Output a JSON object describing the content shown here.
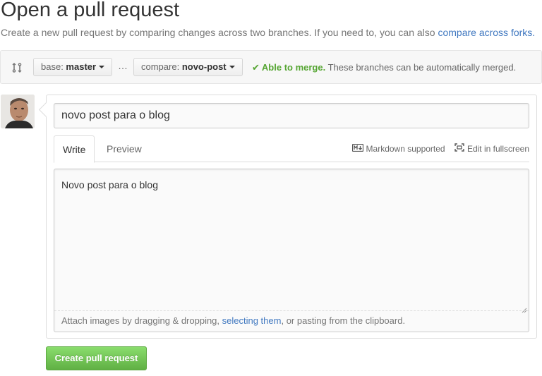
{
  "header": {
    "title": "Open a pull request",
    "subtitle_text": "Create a new pull request by comparing changes across two branches. If you need to, you can also ",
    "subtitle_link": "compare across forks."
  },
  "range": {
    "base_prefix": "base: ",
    "base_branch": "master",
    "ellipsis": "…",
    "compare_prefix": "compare: ",
    "compare_branch": "novo-post",
    "merge_check_icon": "✔",
    "merge_status": "Able to merge.",
    "merge_message": " These branches can be automatically merged.",
    "icons": {
      "compare": "git-compare-icon",
      "check": "check-icon",
      "caret": "caret-down-icon"
    }
  },
  "form": {
    "title_value": "novo post para o blog",
    "tabs": [
      {
        "label": "Write",
        "active": true
      },
      {
        "label": "Preview",
        "active": false
      }
    ],
    "markdown_label": "Markdown supported",
    "fullscreen_label": "Edit in fullscreen",
    "body_value": "Novo post para o blog",
    "drag_hint_before": "Attach images by dragging & dropping, ",
    "drag_hint_link": "selecting them",
    "drag_hint_after": ", or pasting from the clipboard."
  },
  "submit": {
    "label": "Create pull request"
  },
  "colors": {
    "accent_link": "#4078c0",
    "success": "#55a532",
    "button_green": "#60b044"
  }
}
